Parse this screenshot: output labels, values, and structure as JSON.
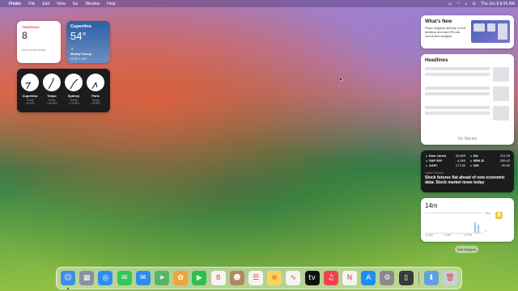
{
  "menubar": {
    "apple": "",
    "app": "Finder",
    "items": [
      "File",
      "Edit",
      "View",
      "Go",
      "Window",
      "Help"
    ],
    "datetime": "Thu Jun 8  8:35 AM",
    "status_icons": [
      "battery-icon",
      "wifi-icon",
      "search-icon",
      "control-center-icon"
    ]
  },
  "calendar_widget": {
    "weekday": "THURSDAY",
    "day": "8",
    "no_events": "No events today"
  },
  "weather_widget": {
    "city": "Cupertino",
    "temp": "54°",
    "condition": "Mostly Sunny",
    "hi_lo": "H:76° L:54°"
  },
  "clock_widget": {
    "clocks": [
      {
        "city": "Cupertino",
        "day": "Today",
        "offset": "+0HRS",
        "hour": 8,
        "minute": 35
      },
      {
        "city": "Tokyo",
        "day": "Today",
        "offset": "+16HRS",
        "hour": 0,
        "minute": 35
      },
      {
        "city": "Sydney",
        "day": "Today",
        "offset": "+17HRS",
        "hour": 1,
        "minute": 35
      },
      {
        "city": "Paris",
        "day": "Today",
        "offset": "+9HRS",
        "hour": 5,
        "minute": 35
      }
    ]
  },
  "whats_new_widget": {
    "title": "What's New",
    "description": "Place widgets directly on the desktop and add iPhone-connected widgets."
  },
  "headlines_widget": {
    "title": "Headlines",
    "empty": "No Stories"
  },
  "stocks_widget": {
    "rows": [
      {
        "symbol": "Dow Jones",
        "value": "33,665"
      },
      {
        "symbol": "S&P 500",
        "value": "4,269"
      },
      {
        "symbol": "AAPL",
        "value": "177.82"
      },
      {
        "symbol": "BA",
        "value": "211.93"
      },
      {
        "symbol": "BRK-B",
        "value": "335.42"
      },
      {
        "symbol": "DIS",
        "value": "92.52"
      }
    ],
    "source": "Yahoo Finance",
    "headline": "Stock futures flat ahead of new economic data: Stock market news today"
  },
  "screen_time_widget": {
    "total": "14m",
    "x_labels": [
      "12 AM",
      "6 AM",
      "12 PM"
    ],
    "y_labels": [
      "15m",
      "0"
    ],
    "usage_minutes": [
      0,
      0,
      0,
      0,
      0,
      0,
      0,
      0,
      0,
      0,
      0,
      0,
      0,
      0,
      0,
      0,
      0,
      8,
      6,
      0
    ]
  },
  "edit_widgets": "Edit Widgets",
  "dock": {
    "apps": [
      {
        "name": "Finder",
        "glyph": "☺",
        "color": "#3d8ee8",
        "running": true
      },
      {
        "name": "Launchpad",
        "glyph": "▦",
        "color": "#8c8fa3",
        "running": false
      },
      {
        "name": "Safari",
        "glyph": "◎",
        "color": "#2f8ff0",
        "running": false
      },
      {
        "name": "Messages",
        "glyph": "✉",
        "color": "#34c759",
        "running": false
      },
      {
        "name": "Mail",
        "glyph": "✉",
        "color": "#2d8cf0",
        "running": false
      },
      {
        "name": "Maps",
        "glyph": "➤",
        "color": "#57b565",
        "running": false
      },
      {
        "name": "Photos",
        "glyph": "✿",
        "color": "#f0a43a",
        "running": false
      },
      {
        "name": "FaceTime",
        "glyph": "▶",
        "color": "#2fbf4f",
        "running": false
      },
      {
        "name": "Calendar",
        "glyph": "8",
        "color": "#f4f4f4",
        "running": false
      },
      {
        "name": "Contacts",
        "glyph": "☻",
        "color": "#b08a5e",
        "running": false
      },
      {
        "name": "Reminders",
        "glyph": "☰",
        "color": "#f4f4f4",
        "running": false
      },
      {
        "name": "Notes",
        "glyph": "≡",
        "color": "#f6d65a",
        "running": false
      },
      {
        "name": "Freeform",
        "glyph": "∿",
        "color": "#f4f4f4",
        "running": false
      },
      {
        "name": "TV",
        "glyph": "tv",
        "color": "#111111",
        "running": false
      },
      {
        "name": "Music",
        "glyph": "♫",
        "color": "#f2414f",
        "running": false
      },
      {
        "name": "News",
        "glyph": "N",
        "color": "#f4f4f4",
        "running": false
      },
      {
        "name": "App Store",
        "glyph": "A",
        "color": "#1c8ef0",
        "running": false
      },
      {
        "name": "System Settings",
        "glyph": "⚙",
        "color": "#8a8a8e",
        "running": false
      },
      {
        "name": "iPhone Mirroring",
        "glyph": "▯",
        "color": "#3a3a3c",
        "running": false
      },
      {
        "name": "Downloads",
        "glyph": "⬇",
        "color": "#5ea0e6",
        "running": false
      },
      {
        "name": "Trash",
        "glyph": "🗑",
        "color": "#c9ced6",
        "running": false
      }
    ]
  }
}
